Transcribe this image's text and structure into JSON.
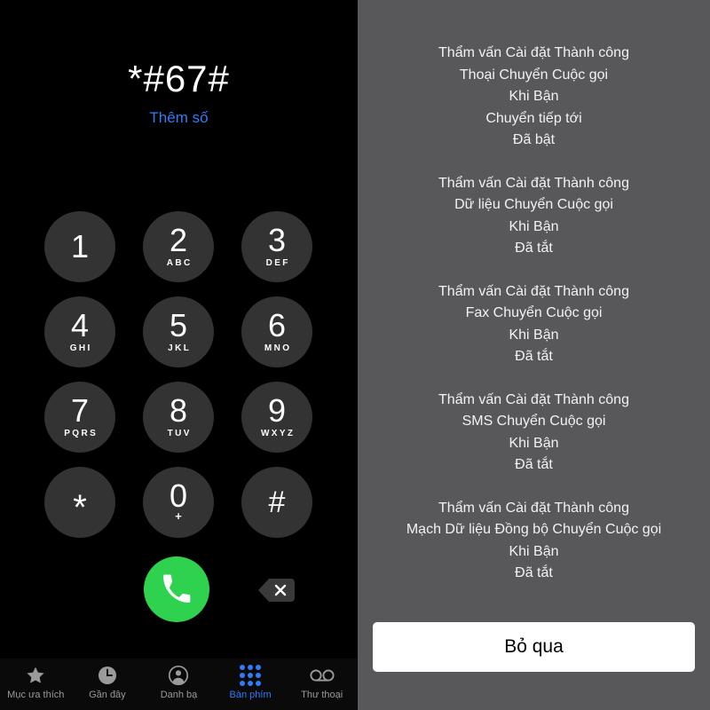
{
  "dialer": {
    "dialed_number": "*#67#",
    "add_number_label": "Thêm số",
    "keys": [
      {
        "digit": "1",
        "letters": ""
      },
      {
        "digit": "2",
        "letters": "ABC"
      },
      {
        "digit": "3",
        "letters": "DEF"
      },
      {
        "digit": "4",
        "letters": "GHI"
      },
      {
        "digit": "5",
        "letters": "JKL"
      },
      {
        "digit": "6",
        "letters": "MNO"
      },
      {
        "digit": "7",
        "letters": "PQRS"
      },
      {
        "digit": "8",
        "letters": "TUV"
      },
      {
        "digit": "9",
        "letters": "WXYZ"
      },
      {
        "digit": "*",
        "letters": ""
      },
      {
        "digit": "0",
        "letters": "+"
      },
      {
        "digit": "#",
        "letters": ""
      }
    ],
    "call_icon": "phone-handset-icon",
    "delete_icon": "backspace-delete-icon",
    "call_button_color": "#2fd24f",
    "key_color": "#333333"
  },
  "tab_bar": {
    "active_index": 3,
    "active_color": "#2f7cf6",
    "inactive_color": "#9a9a9a",
    "tabs": [
      {
        "label": "Mục ưa thích",
        "icon": "star-icon"
      },
      {
        "label": "Gần đây",
        "icon": "clock-icon"
      },
      {
        "label": "Danh bạ",
        "icon": "person-circle-icon"
      },
      {
        "label": "Bàn phím",
        "icon": "keypad-grid-icon"
      },
      {
        "label": "Thư thoại",
        "icon": "voicemail-icon"
      }
    ]
  },
  "dialog": {
    "background_color": "#58585a",
    "blocks": [
      {
        "lines": [
          "Thẩm vấn Cài đặt Thành công",
          "Thoại Chuyển Cuộc gọi",
          "Khi Bận",
          "Chuyển tiếp tới",
          "Đã bật"
        ]
      },
      {
        "lines": [
          "Thẩm vấn Cài đặt Thành công",
          "Dữ liệu Chuyển Cuộc gọi",
          "Khi Bận",
          "Đã tắt"
        ]
      },
      {
        "lines": [
          "Thẩm vấn Cài đặt Thành công",
          "Fax Chuyển Cuộc gọi",
          "Khi Bận",
          "Đã tắt"
        ]
      },
      {
        "lines": [
          "Thẩm vấn Cài đặt Thành công",
          "SMS Chuyển Cuộc gọi",
          "Khi Bận",
          "Đã tắt"
        ]
      },
      {
        "lines": [
          "Thẩm vấn Cài đặt Thành công",
          "Mạch Dữ liệu Đồng bộ Chuyển Cuộc gọi",
          "Khi Bận",
          "Đã tắt"
        ]
      }
    ],
    "dismiss_label": "Bỏ qua"
  }
}
